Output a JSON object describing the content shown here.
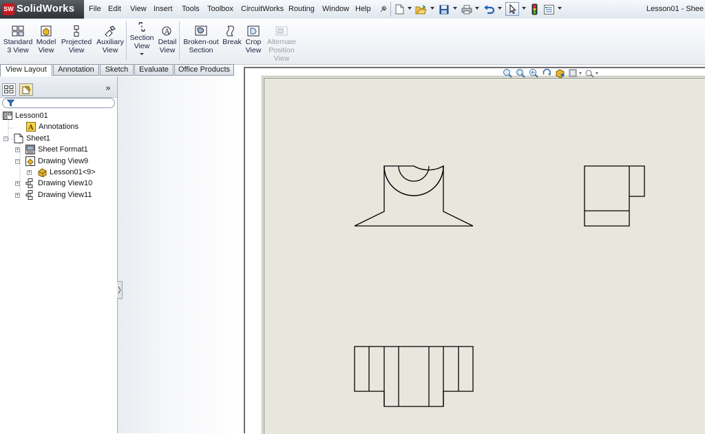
{
  "app": {
    "name": "SolidWorks",
    "logo_mark": "SW",
    "document_title": "Lesson01 - Shee"
  },
  "menu": {
    "items": [
      "File",
      "Edit",
      "View",
      "Insert",
      "Tools",
      "Toolbox",
      "CircuitWorks",
      "Routing",
      "Window",
      "Help"
    ]
  },
  "quick_access": {
    "icons": [
      "pin-icon",
      "new-document-icon",
      "open-folder-icon",
      "save-icon",
      "print-icon",
      "undo-icon",
      "select-pointer-icon",
      "traffic-light-icon",
      "options-icon"
    ]
  },
  "command_manager": {
    "commands": [
      {
        "id": "standard-3-view",
        "label_lines": [
          "Standard",
          "3 View"
        ],
        "icon": "standard-3-view-icon",
        "enabled": true
      },
      {
        "id": "model-view",
        "label_lines": [
          "Model",
          "View"
        ],
        "icon": "model-view-icon",
        "enabled": true
      },
      {
        "id": "projected-view",
        "label_lines": [
          "Projected",
          "View"
        ],
        "icon": "projected-view-icon",
        "enabled": true
      },
      {
        "id": "auxiliary-view",
        "label_lines": [
          "Auxiliary",
          "View"
        ],
        "icon": "auxiliary-view-icon",
        "enabled": true
      },
      {
        "id": "section-view",
        "label_lines": [
          "Section",
          "View"
        ],
        "icon": "section-view-icon",
        "enabled": true
      },
      {
        "id": "detail-view",
        "label_lines": [
          "Detail",
          "View"
        ],
        "icon": "detail-view-icon",
        "enabled": true
      },
      {
        "id": "broken-out-section",
        "label_lines": [
          "Broken-out",
          "Section"
        ],
        "icon": "broken-out-section-icon",
        "enabled": true
      },
      {
        "id": "break",
        "label_lines": [
          "Break"
        ],
        "icon": "break-icon",
        "enabled": true
      },
      {
        "id": "crop-view",
        "label_lines": [
          "Crop",
          "View"
        ],
        "icon": "crop-view-icon",
        "enabled": true
      },
      {
        "id": "alternate-position-view",
        "label_lines": [
          "Alternate",
          "Position",
          "View"
        ],
        "icon": "alternate-position-view-icon",
        "enabled": false
      }
    ]
  },
  "tabs": [
    {
      "label": "View Layout",
      "active": true
    },
    {
      "label": "Annotation",
      "active": false
    },
    {
      "label": "Sketch",
      "active": false
    },
    {
      "label": "Evaluate",
      "active": false
    },
    {
      "label": "Office Products",
      "active": false
    }
  ],
  "feature_tree": {
    "panel_tabs": [
      "feature-manager-tab-icon",
      "property-manager-tab-icon"
    ],
    "expand_label": "»",
    "nodes": [
      {
        "label": "Lesson01",
        "icon": "drawing-document-icon",
        "depth": 0,
        "expander": false
      },
      {
        "label": "Annotations",
        "icon": "annotations-icon",
        "depth": 1,
        "expander": false
      },
      {
        "label": "Sheet1",
        "icon": "sheet-icon",
        "depth": 1,
        "expander": "minus"
      },
      {
        "label": "Sheet Format1",
        "icon": "sheet-format-icon",
        "depth": 2,
        "expander": "plus"
      },
      {
        "label": "Drawing View9",
        "icon": "drawing-view-icon",
        "depth": 2,
        "expander": "minus"
      },
      {
        "label": "Lesson01<9>",
        "icon": "part-icon",
        "depth": 3,
        "expander": "plus"
      },
      {
        "label": "Drawing View10",
        "icon": "drawing-view-projected-icon",
        "depth": 2,
        "expander": "plus"
      },
      {
        "label": "Drawing View11",
        "icon": "drawing-view-projected-icon",
        "depth": 2,
        "expander": "plus"
      }
    ]
  },
  "heads_up_toolbar": {
    "icons": [
      "zoom-to-fit-icon",
      "zoom-to-area-icon",
      "previous-view-icon",
      "rotate-icon",
      "display-style-icon",
      "hide-show-icon",
      "view-settings-icon"
    ]
  },
  "drawing": {
    "views": [
      {
        "name": "front-view",
        "description": "front view of part with semicircular cutout"
      },
      {
        "name": "right-view",
        "description": "right side projected view"
      },
      {
        "name": "top-view",
        "description": "top projected view"
      }
    ]
  },
  "colors": {
    "sheet": "#e8e7de",
    "accent_logo": "#c8161d",
    "geometry": "#000000"
  }
}
